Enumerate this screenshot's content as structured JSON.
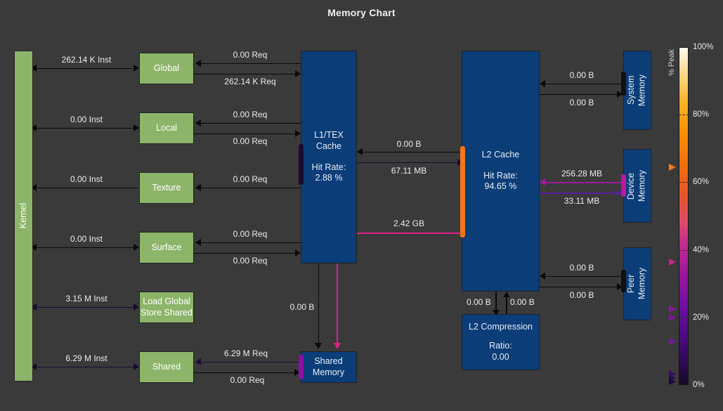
{
  "title": "Memory Chart",
  "theme": {
    "bg": "#3a3a3a",
    "green": "#8db56a",
    "blue": "#0b3d78",
    "arrow_black": "#0a0a0a",
    "arrow_darkpurple": "#1a0b33",
    "arrow_purple": "#5b1d9e",
    "arrow_magenta": "#a4189e",
    "arrow_pink": "#e0218a",
    "accent_orange": "#f4761b",
    "accent_purple": "#8a0fa8",
    "accent_magenta": "#b8189f",
    "accent_black": "#111111"
  },
  "units": {
    "kernel": "Kernel"
  },
  "nodes": {
    "kernel": {
      "label": "Kernel"
    },
    "global": {
      "label": "Global"
    },
    "local": {
      "label": "Local"
    },
    "texture": {
      "label": "Texture"
    },
    "surface": {
      "label": "Surface"
    },
    "lgss": {
      "label": "Load Global\nStore Shared"
    },
    "shared": {
      "label": "Shared"
    },
    "l1tex": {
      "name": "L1/TEX\nCache",
      "metric_label": "Hit Rate:",
      "metric_value": "2.88 %"
    },
    "l2": {
      "name": "L2 Cache",
      "metric_label": "Hit Rate:",
      "metric_value": "94.65 %"
    },
    "shared_memory": {
      "label": "Shared\nMemory"
    },
    "system_memory": {
      "label": "System\nMemory"
    },
    "device_memory": {
      "label": "Device\nMemory"
    },
    "peer_memory": {
      "label": "Peer\nMemory"
    },
    "l2_compression": {
      "name": "L2 Compression",
      "metric_label": "Ratio:",
      "metric_value": "0.00"
    }
  },
  "edges": {
    "kernel_global": "262.14 K Inst",
    "kernel_local": "0.00 Inst",
    "kernel_texture": "0.00 Inst",
    "kernel_surface": "0.00 Inst",
    "kernel_lgss": "3.15 M Inst",
    "kernel_shared": "6.29 M Inst",
    "global_l1_in": "0.00 Req",
    "global_l1_out": "262.14 K Req",
    "local_l1_in": "0.00 Req",
    "local_l1_out": "0.00 Req",
    "texture_l1_in": "0.00 Req",
    "surface_l1_in": "0.00 Req",
    "surface_l1_out": "0.00 Req",
    "shared_sm_in": "6.29 M Req",
    "shared_sm_out": "0.00 Req",
    "l1_l2_in": "0.00 B",
    "l1_l2_out": "67.11 MB",
    "l1_sm": "0.00 B",
    "l2_sm": "2.42 GB",
    "l2_sys_in": "0.00 B",
    "l2_sys_out": "0.00 B",
    "l2_dev_in": "256.28 MB",
    "l2_dev_out": "33.11 MB",
    "l2_peer_in": "0.00 B",
    "l2_peer_out": "0.00 B",
    "l2_comp_down": "0.00 B",
    "l2_comp_up": "0.00 B"
  },
  "colorbar": {
    "axis_label": "% Peak",
    "ticks": [
      {
        "label": "100%",
        "value": 100
      },
      {
        "label": "80%",
        "value": 80
      },
      {
        "label": "60%",
        "value": 60
      },
      {
        "label": "40%",
        "value": 40
      },
      {
        "label": "20%",
        "value": 20
      },
      {
        "label": "0%",
        "value": 0
      }
    ],
    "markers": [
      {
        "value": 64.5,
        "color": "#f4761b"
      },
      {
        "value": 36.3,
        "color": "#c4278f"
      },
      {
        "value": 22.5,
        "color": "#8f12a6"
      },
      {
        "value": 20.0,
        "color": "#8a0fa8"
      },
      {
        "value": 12.9,
        "color": "#7a14a0"
      },
      {
        "value": 3.4,
        "color": "#3b0a6e"
      },
      {
        "value": 2.0,
        "color": "#2a0a50"
      },
      {
        "value": 1.0,
        "color": "#1c0a3c"
      }
    ]
  }
}
